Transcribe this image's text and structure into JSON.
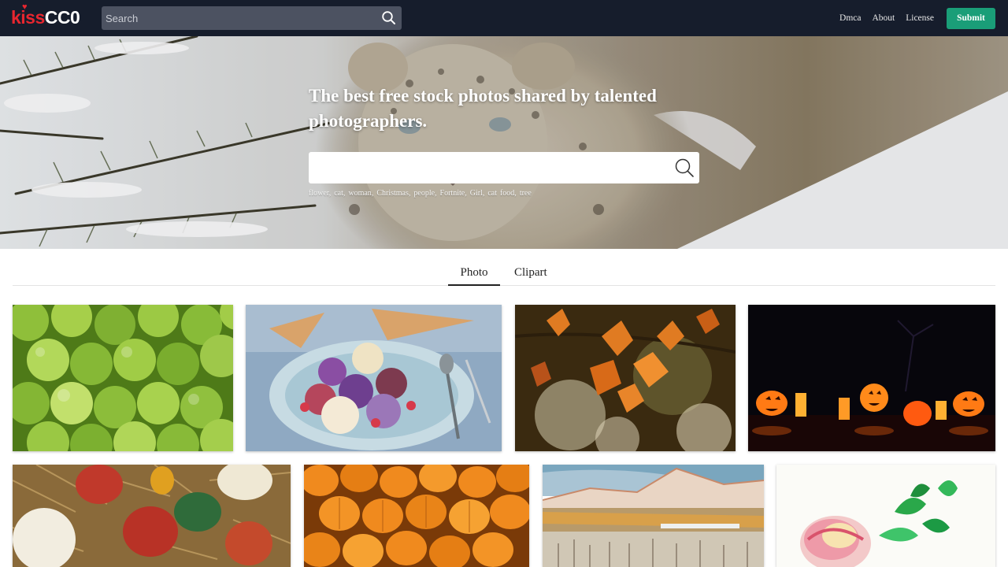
{
  "header": {
    "logo_kiss": "kiss",
    "logo_cc0": "CC0",
    "search_placeholder": "Search",
    "nav": [
      {
        "label": "Dmca"
      },
      {
        "label": "About"
      },
      {
        "label": "License"
      }
    ],
    "submit_label": "Submit"
  },
  "hero": {
    "title": "The best free stock photos shared by talented photographers.",
    "tags": [
      "flower,",
      "cat,",
      "woman,",
      "Christmas,",
      "people,",
      "Fortnite,",
      "Girl,",
      "cat",
      "food,",
      "tree"
    ]
  },
  "tabs": [
    {
      "label": "Photo",
      "active": true
    },
    {
      "label": "Clipart",
      "active": false
    }
  ],
  "colors": {
    "header_bg": "#161d2c",
    "logo_red": "#e8262f",
    "submit_green": "#1a9e78"
  },
  "icons": {
    "header_search": "search-icon",
    "hero_search": "search-icon"
  },
  "gallery_count": 8
}
